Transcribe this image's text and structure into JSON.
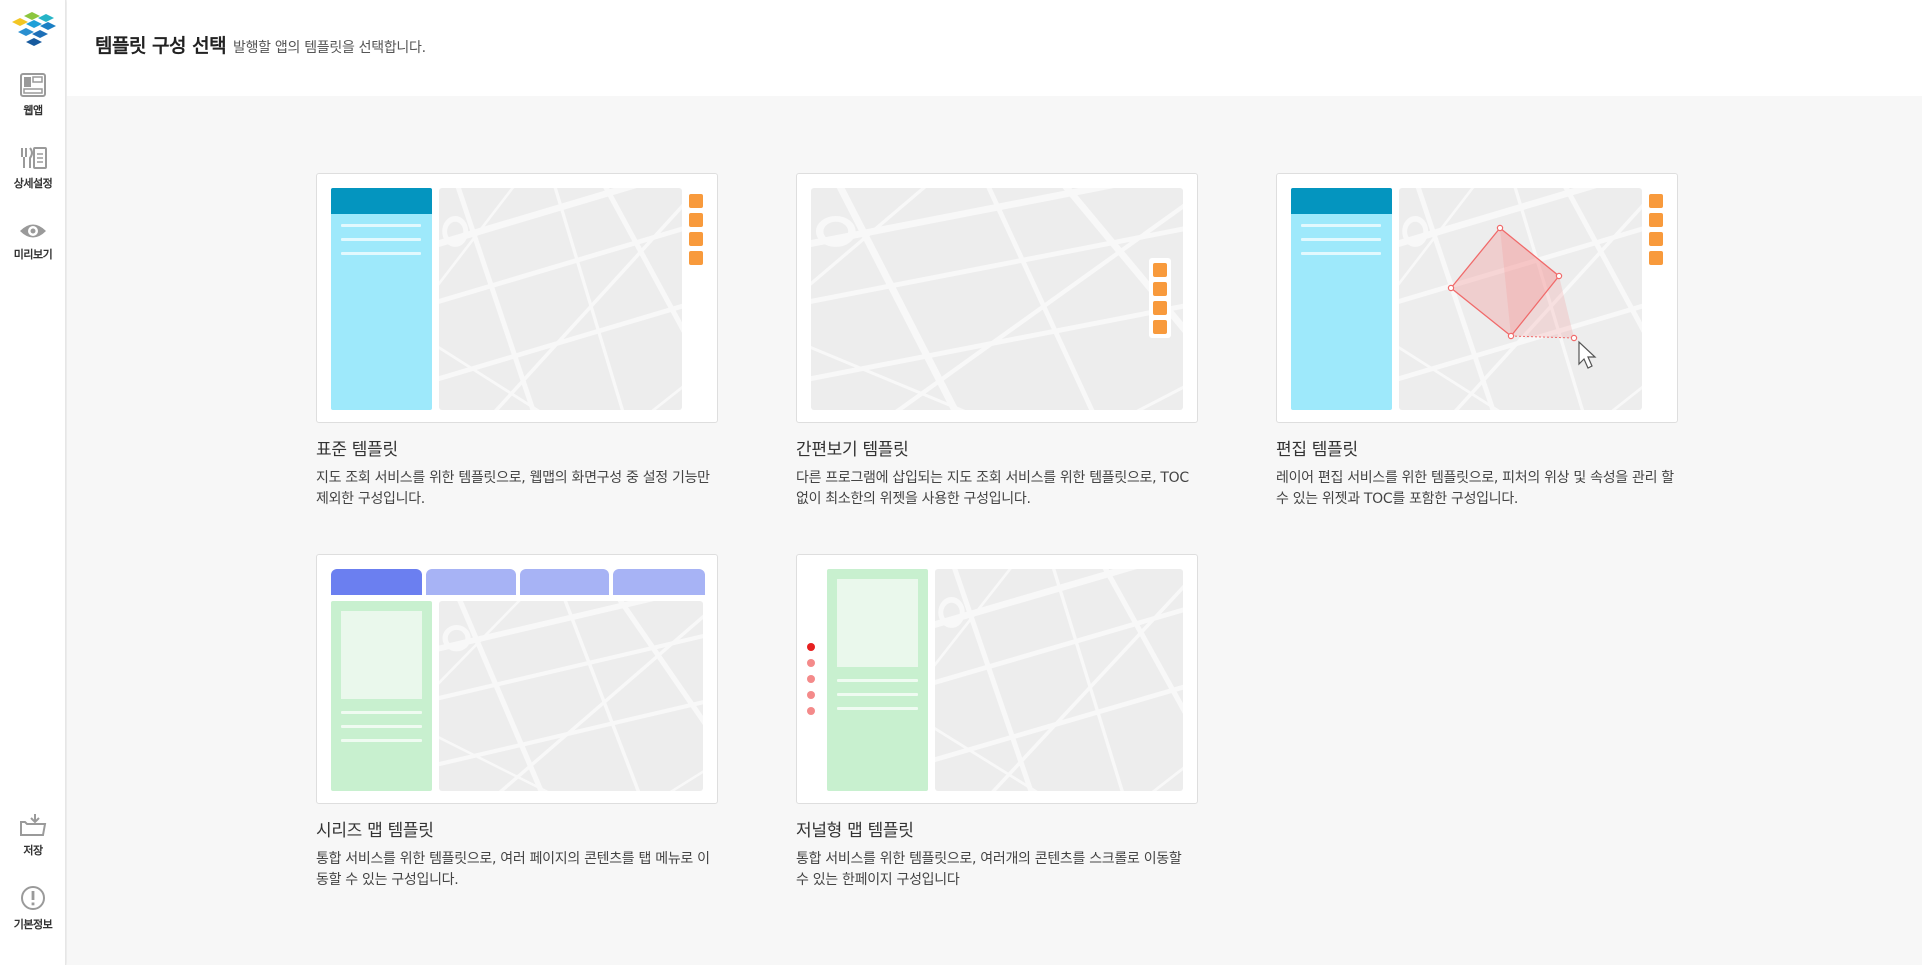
{
  "sidebar": {
    "logo_icon": "logo-icon",
    "nav_top": [
      {
        "label": "웹앱",
        "icon": "layout-icon"
      },
      {
        "label": "상세설정",
        "icon": "settings-icon"
      },
      {
        "label": "미리보기",
        "icon": "eye-icon"
      }
    ],
    "nav_bottom": [
      {
        "label": "저장",
        "icon": "save-icon"
      },
      {
        "label": "기본정보",
        "icon": "info-icon"
      }
    ]
  },
  "header": {
    "title": "템플릿 구성 선택",
    "subtitle": "발행할 앱의 템플릿을 선택합니다."
  },
  "templates": [
    {
      "title": "표준 템플릿",
      "desc": "지도 조회 서비스를 위한 템플릿으로, 웹맵의 화면구성 중 설정 기능만 제외한 구성입니다."
    },
    {
      "title": "간편보기 템플릿",
      "desc": "다른 프로그램에 삽입되는 지도 조회 서비스를 위한 템플릿으로, TOC없이 최소한의 위젯을 사용한 구성입니다."
    },
    {
      "title": "편집 템플릿",
      "desc": "레이어 편집 서비스를 위한 템플릿으로, 피처의 위상 및 속성을 관리 할 수 있는 위젯과 TOC를 포함한 구성입니다."
    },
    {
      "title": "시리즈 맵 템플릿",
      "desc": "통합 서비스를 위한 템플릿으로, 여러 페이지의 콘텐츠를 탭 메뉴로 이동할 수 있는 구성입니다."
    },
    {
      "title": "저널형 맵 템플릿",
      "desc": "통합 서비스를 위한 템플릿으로, 여러개의 콘텐츠를 스크롤로 이동할 수 있는 한페이지 구성입니다"
    }
  ],
  "colors": {
    "accent_orange": "#f89a3c",
    "panel_blue": "#9ee9fb",
    "header_blue": "#0495bf",
    "panel_green": "#c8f0cf",
    "tab_active": "#6b7ff0",
    "tab_inactive": "#a7b3f5"
  }
}
